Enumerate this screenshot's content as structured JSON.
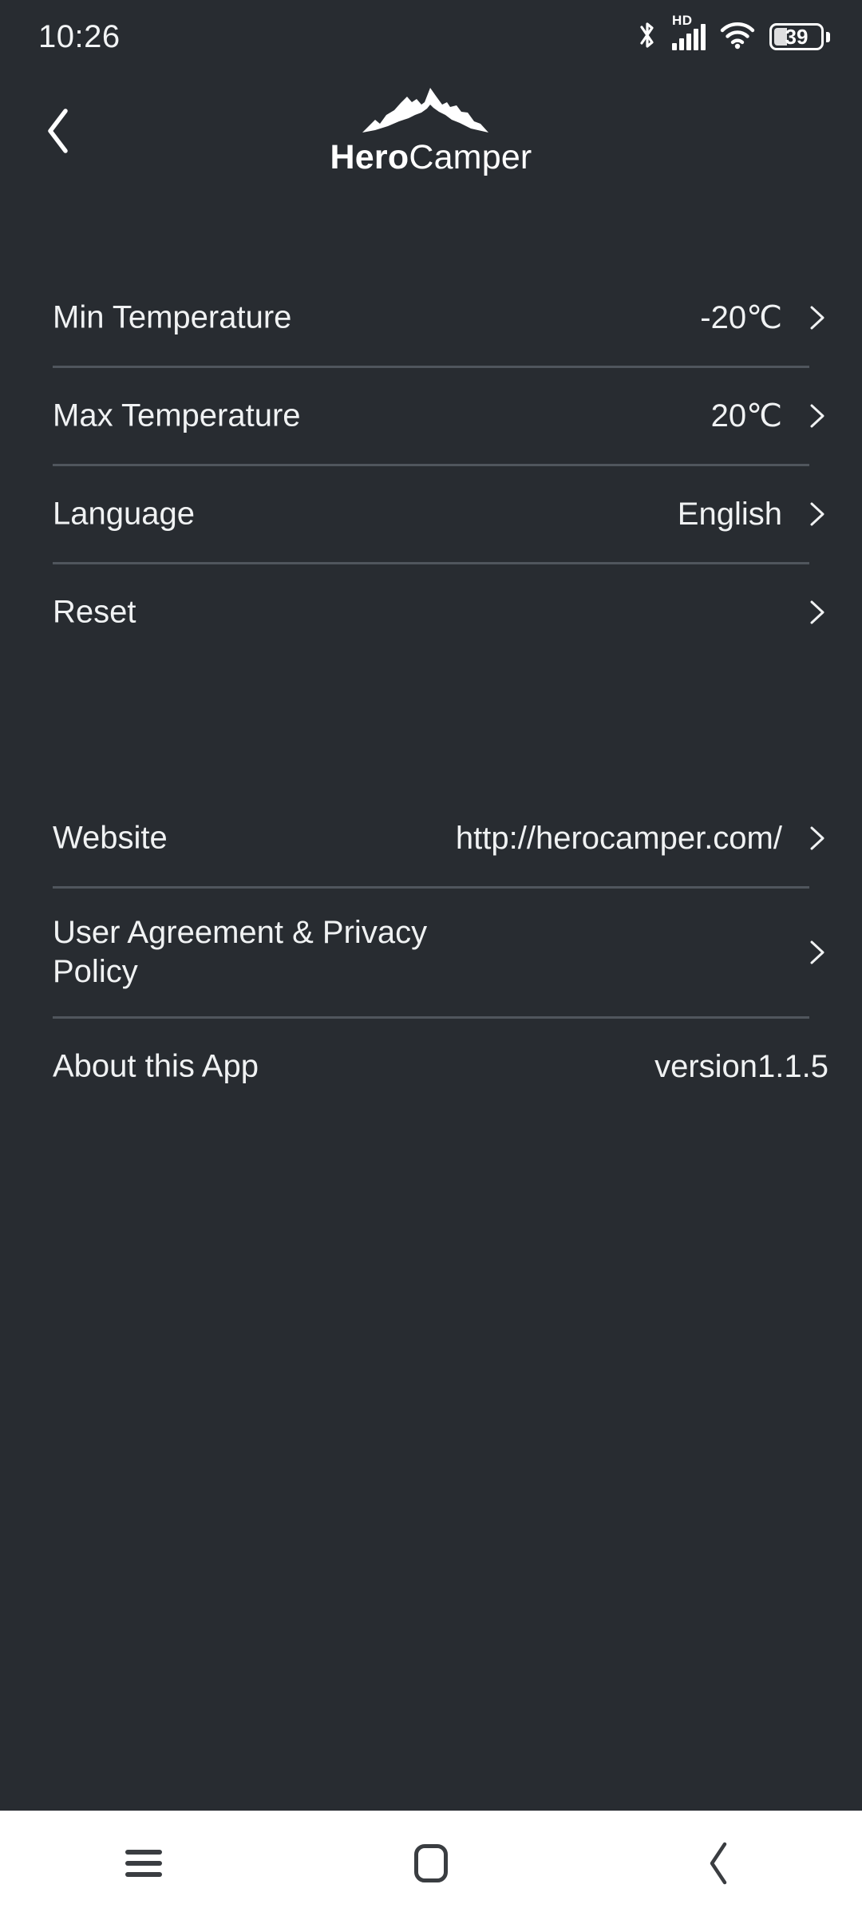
{
  "status_bar": {
    "time": "10:26",
    "battery_percent": "39",
    "network_label": "HD",
    "icons": [
      "bluetooth-icon",
      "signal-icon",
      "wifi-icon",
      "battery-icon"
    ]
  },
  "header": {
    "back_label": "",
    "brand_bold": "Hero",
    "brand_light": "Camper",
    "logo": "mountain-icon"
  },
  "settings_group": [
    {
      "label": "Min Temperature",
      "value": "-20℃",
      "chevron": true
    },
    {
      "label": "Max Temperature",
      "value": "20℃",
      "chevron": true
    },
    {
      "label": "Language",
      "value": "English",
      "chevron": true
    },
    {
      "label": "Reset",
      "value": "",
      "chevron": true
    }
  ],
  "info_group": [
    {
      "label": "Website",
      "value": "http://herocamper.com/",
      "chevron": true
    },
    {
      "label": "User Agreement & Privacy Policy",
      "value": "",
      "chevron": true
    },
    {
      "label": "About this App",
      "value": "version1.1.5",
      "chevron": false
    }
  ],
  "nav_bar": {
    "recents_label": "recent-apps",
    "home_label": "home",
    "back_label": "back"
  },
  "colors": {
    "background": "#282c31",
    "text": "#f0f2f3",
    "divider": "#50565d",
    "navbar_bg": "#ffffff",
    "navbar_icon": "#3a3d41"
  }
}
